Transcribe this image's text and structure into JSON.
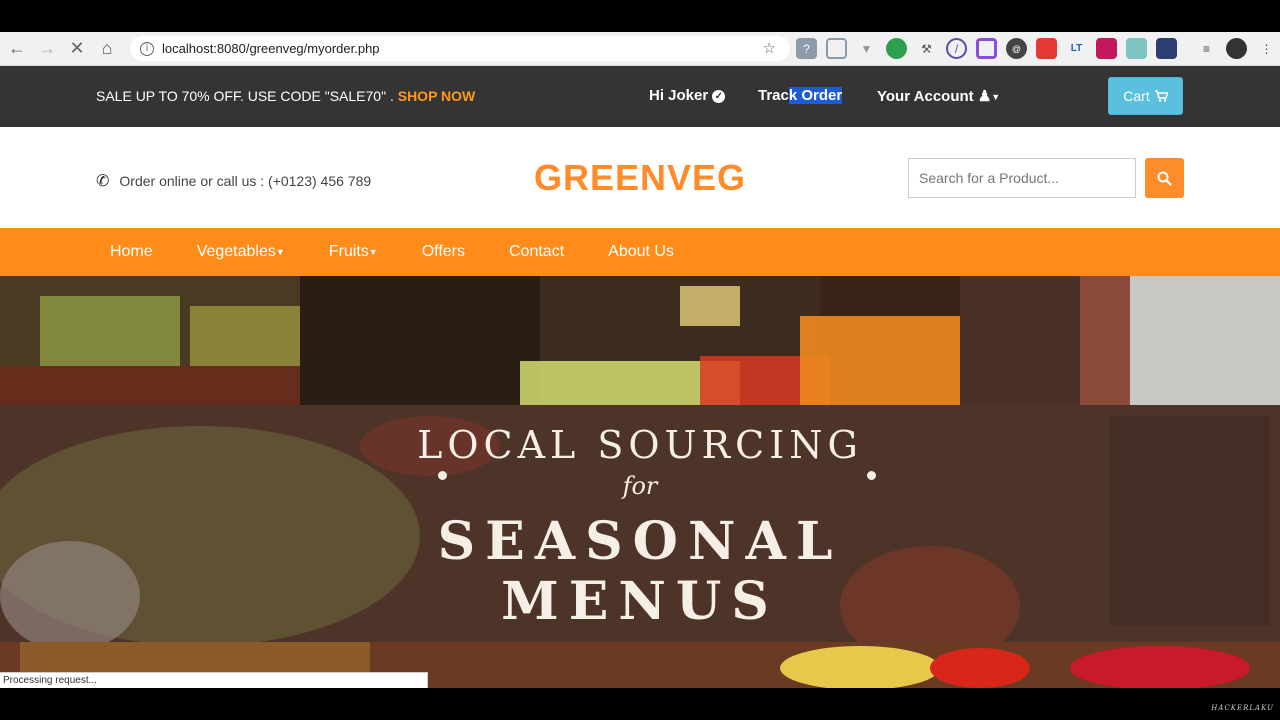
{
  "browser": {
    "url": "localhost:8080/greenveg/myorder.php",
    "status": "Processing request..."
  },
  "promo": {
    "text": "SALE UP TO 70% OFF. USE CODE \"SALE70\" . ",
    "shop_now": "SHOP NOW",
    "greeting": "Hi Joker",
    "track_a": "Trac",
    "track_b": "k Order",
    "account": "Your Account",
    "cart": "Cart"
  },
  "header": {
    "phone": "Order online or call us : (+0123) 456 789",
    "logo": "GREENVEG",
    "search_placeholder": "Search for a Product..."
  },
  "menu": [
    "Home",
    "Vegetables",
    "Fruits",
    "Offers",
    "Contact",
    "About Us"
  ],
  "hero": {
    "line1": "LOCAL SOURCING",
    "line2": "for",
    "line3": "SEASONAL",
    "line4": "MENUS"
  },
  "watermark": "HACKERLAKU",
  "colors": {
    "accent": "#ff8c1a",
    "promo_bg": "#343434",
    "cart": "#5bc0de"
  }
}
